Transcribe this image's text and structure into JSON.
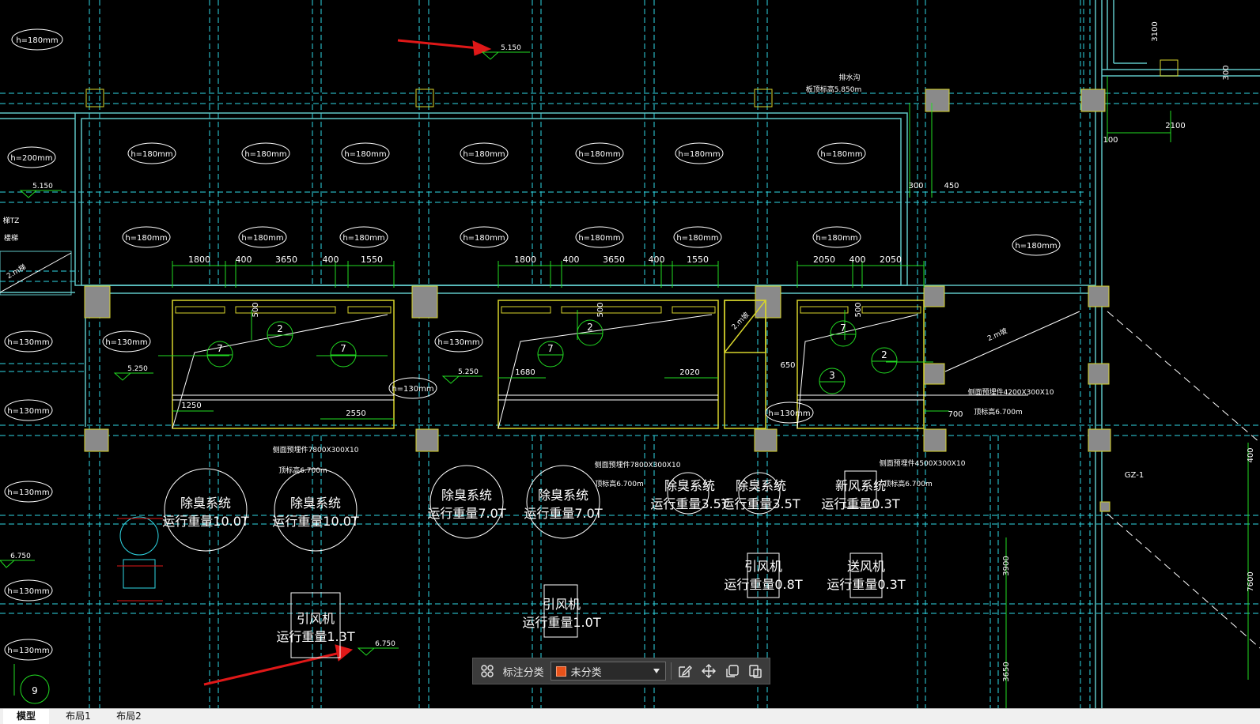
{
  "drawing": {
    "slab_thickness_labels": {
      "top_left": "h=180mm",
      "row1": [
        "h=180mm",
        "h=180mm",
        "h=180mm",
        "h=180mm",
        "h=180mm",
        "h=180mm",
        "h=180mm"
      ],
      "row2": [
        "h=180mm",
        "h=180mm",
        "h=180mm",
        "h=180mm",
        "h=180mm",
        "h=180mm",
        "h=180mm",
        "h=180mm"
      ],
      "left_200": "h=200mm",
      "h130": [
        "h=130mm",
        "h=130mm",
        "h=130mm",
        "h=130mm",
        "h=130mm",
        "h=130mm",
        "h=130mm",
        "h=130mm",
        "h=130mm",
        "h=130mm"
      ]
    },
    "elevations": [
      "5.150",
      "5.150",
      "5.250",
      "5.250",
      "6.750",
      "6.750"
    ],
    "small_text": [
      "排水沟",
      "板顶标高5.850m",
      "梯TZ",
      "楼梯",
      "2.m梯"
    ],
    "dims_top_right": [
      "3100",
      "300",
      "2100",
      "100",
      "300",
      "450"
    ],
    "dims_group1": [
      "1800",
      "400",
      "3650",
      "400",
      "1550"
    ],
    "dims_group2": [
      "1800",
      "400",
      "3650",
      "400",
      "1550"
    ],
    "dims_group3": [
      "2050",
      "400",
      "2050"
    ],
    "dims_misc": [
      "500",
      "500",
      "500",
      "1250",
      "2550",
      "1680",
      "2020",
      "650",
      "700"
    ],
    "circle_tags": [
      "7",
      "2",
      "7",
      "2",
      "7",
      "7",
      "2",
      "3",
      "7"
    ],
    "beam_notes": [
      "侧面预埋件7800X300X10",
      "顶标高6.700m",
      "侧面预埋件7800X300X10",
      "顶标高6.700m",
      "侧面预埋件4500X300X10",
      "顶标高6.700m",
      "侧面预埋件4200X300X10",
      "顶标高6.700m"
    ],
    "slope_labels": [
      "2.m坡",
      "2.m坡"
    ],
    "equipment": [
      {
        "name": "除臭系统",
        "weight": "运行重量10.0T"
      },
      {
        "name": "除臭系统",
        "weight": "运行重量10.0T"
      },
      {
        "name": "除臭系统",
        "weight": "运行重量7.0T"
      },
      {
        "name": "除臭系统",
        "weight": "运行重量7.0T"
      },
      {
        "name": "除臭系统",
        "weight": "运行重量3.5T"
      },
      {
        "name": "除臭系统",
        "weight": "运行重量3.5T"
      },
      {
        "name": "新风系统",
        "weight": "运行重量0.3T"
      },
      {
        "name": "引风机",
        "weight": "运行重量0.8T"
      },
      {
        "name": "送风机",
        "weight": "运行重量0.3T"
      },
      {
        "name": "引风机",
        "weight": "运行重量1.0T"
      },
      {
        "name": "引风机",
        "weight": "运行重量1.3T"
      }
    ],
    "column_tag": "GZ-1",
    "right_dims": [
      "400",
      "3900",
      "7600",
      "3650"
    ],
    "axis_tag": "9"
  },
  "toolbar": {
    "category_label": "标注分类",
    "category_value": "未分类"
  },
  "tabs": [
    "模型",
    "布局1",
    "布局2"
  ],
  "colors": {
    "background": "#000000",
    "grid": "#2fd8e6",
    "wall": "#5fc6c6",
    "yellow": "#d7d42c",
    "green": "#22dd22",
    "white": "#ffffff",
    "arrow": "#e01818",
    "column": "#8a8a8a",
    "swatch": "#e8521a"
  },
  "icons": {
    "toolbar": [
      "grid-apps-icon",
      "edit-icon",
      "move-icon",
      "copy-icon",
      "paste-icon",
      "chevron-down-icon"
    ]
  }
}
